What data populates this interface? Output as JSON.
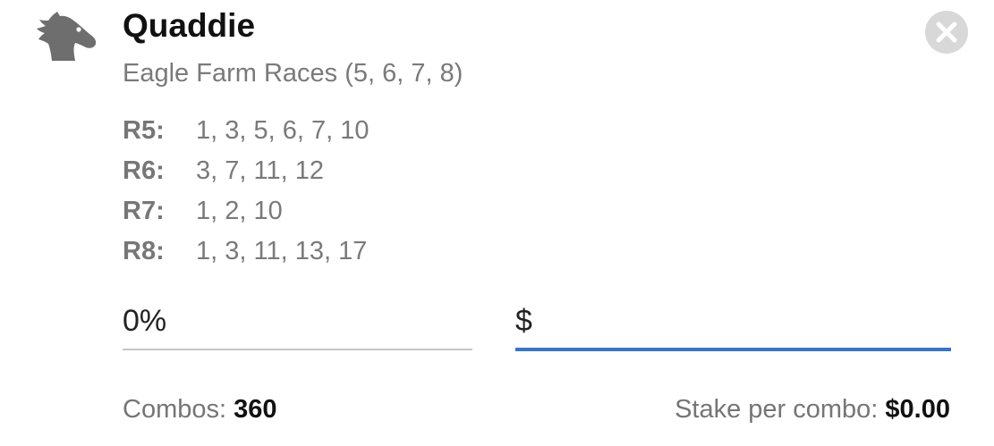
{
  "header": {
    "icon": "horse-head-icon",
    "title": "Quaddie",
    "subtitle": "Eagle Farm Races (5, 6, 7, 8)",
    "close_icon": "close-icon"
  },
  "selections": [
    {
      "race": "R5:",
      "runners": "1, 3, 5, 6, 7, 10"
    },
    {
      "race": "R6:",
      "runners": "3, 7, 11, 12"
    },
    {
      "race": "R7:",
      "runners": "1, 2, 10"
    },
    {
      "race": "R8:",
      "runners": "1, 3, 11, 13, 17"
    }
  ],
  "inputs": {
    "percentage_value": "0%",
    "stake_prefix": "$",
    "stake_value": ""
  },
  "footer": {
    "combos_label": "Combos:",
    "combos_value": "360",
    "stake_per_combo_label": "Stake per combo:",
    "stake_per_combo_value": "$0.00"
  },
  "colors": {
    "accent_underline": "#3a75c4",
    "inactive_underline": "#c6c6c6",
    "close_button_bg": "#d8d8d8",
    "icon_gray": "#6e6e6e"
  }
}
